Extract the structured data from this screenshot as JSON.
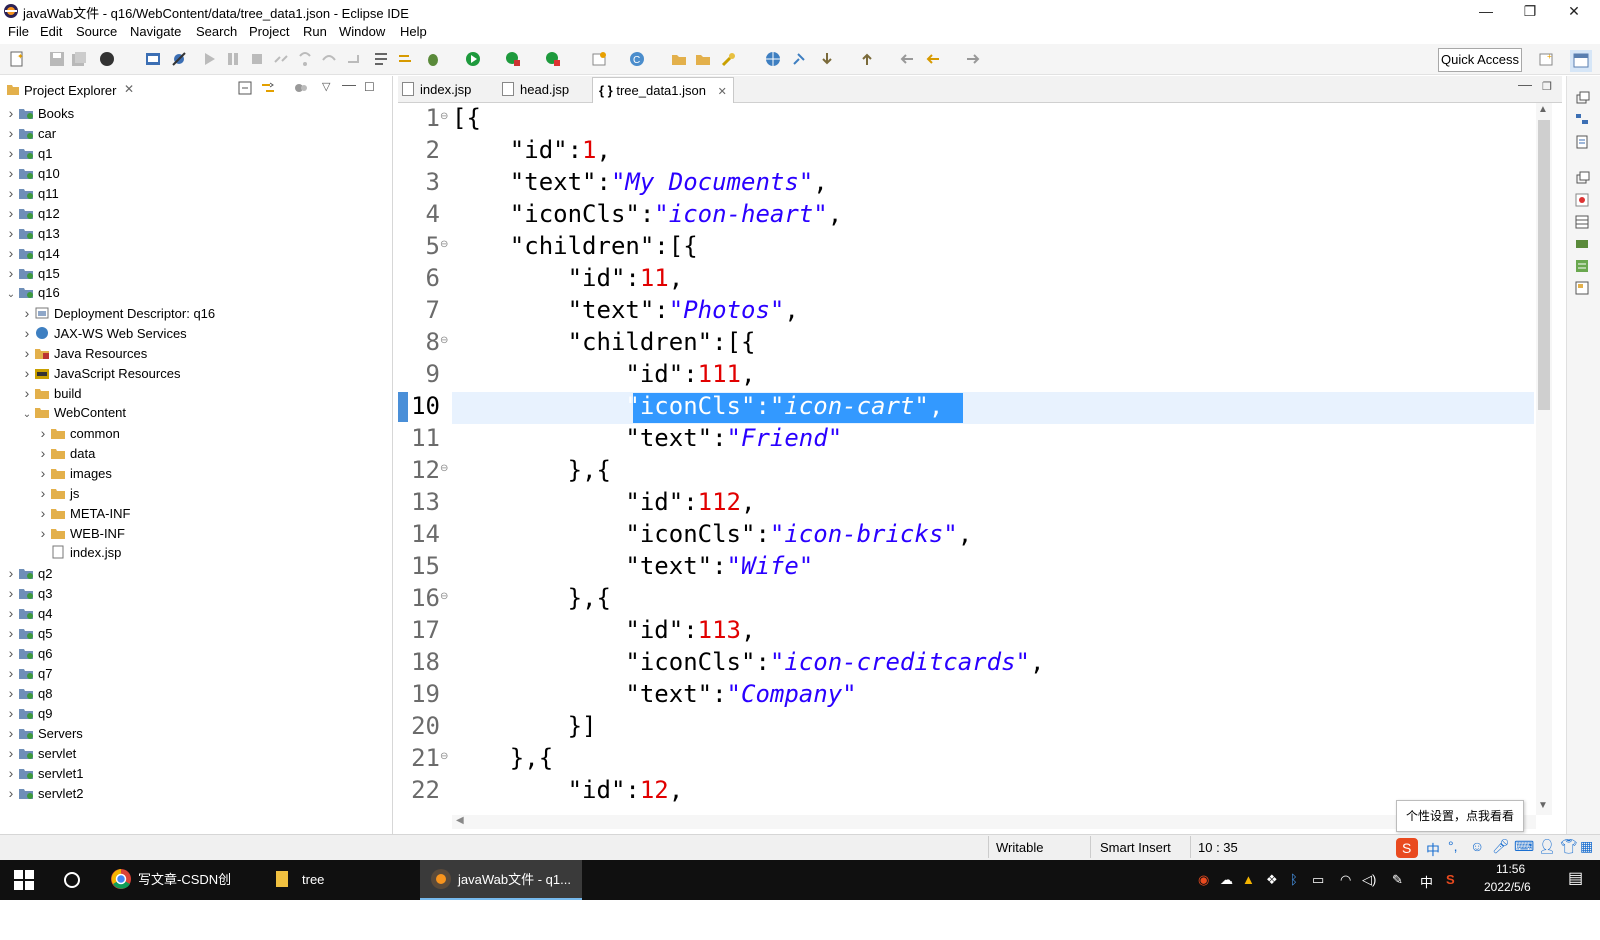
{
  "window": {
    "title": "javaWab文件 - q16/WebContent/data/tree_data1.json - Eclipse IDE",
    "minimize": "—",
    "maximize": "❐",
    "close": "✕"
  },
  "menu": [
    "File",
    "Edit",
    "Source",
    "Navigate",
    "Search",
    "Project",
    "Run",
    "Window",
    "Help"
  ],
  "toolbar": {
    "quick_access": "Quick Access"
  },
  "explorer": {
    "tab_label": "Project Explorer",
    "items": [
      {
        "label": "Books",
        "expanded": false,
        "depth": 0,
        "type": "project"
      },
      {
        "label": "car",
        "expanded": false,
        "depth": 0,
        "type": "project"
      },
      {
        "label": "q1",
        "expanded": false,
        "depth": 0,
        "type": "project"
      },
      {
        "label": "q10",
        "expanded": false,
        "depth": 0,
        "type": "project"
      },
      {
        "label": "q11",
        "expanded": false,
        "depth": 0,
        "type": "project"
      },
      {
        "label": "q12",
        "expanded": false,
        "depth": 0,
        "type": "project"
      },
      {
        "label": "q13",
        "expanded": false,
        "depth": 0,
        "type": "project"
      },
      {
        "label": "q14",
        "expanded": false,
        "depth": 0,
        "type": "project"
      },
      {
        "label": "q15",
        "expanded": false,
        "depth": 0,
        "type": "project"
      },
      {
        "label": "q16",
        "expanded": true,
        "depth": 0,
        "type": "project"
      },
      {
        "label": "Deployment Descriptor: q16",
        "expanded": false,
        "depth": 1,
        "type": "descriptor"
      },
      {
        "label": "JAX-WS Web Services",
        "expanded": false,
        "depth": 1,
        "type": "webservice"
      },
      {
        "label": "Java Resources",
        "expanded": false,
        "depth": 1,
        "type": "javares"
      },
      {
        "label": "JavaScript Resources",
        "expanded": false,
        "depth": 1,
        "type": "jsres"
      },
      {
        "label": "build",
        "expanded": false,
        "depth": 1,
        "type": "folder"
      },
      {
        "label": "WebContent",
        "expanded": true,
        "depth": 1,
        "type": "folder"
      },
      {
        "label": "common",
        "expanded": false,
        "depth": 2,
        "type": "folder"
      },
      {
        "label": "data",
        "expanded": false,
        "depth": 2,
        "type": "folder"
      },
      {
        "label": "images",
        "expanded": false,
        "depth": 2,
        "type": "folder"
      },
      {
        "label": "js",
        "expanded": false,
        "depth": 2,
        "type": "folder"
      },
      {
        "label": "META-INF",
        "expanded": false,
        "depth": 2,
        "type": "folder"
      },
      {
        "label": "WEB-INF",
        "expanded": false,
        "depth": 2,
        "type": "folder"
      },
      {
        "label": "index.jsp",
        "expanded": null,
        "depth": 2,
        "type": "file"
      },
      {
        "label": "q2",
        "expanded": false,
        "depth": 0,
        "type": "project"
      },
      {
        "label": "q3",
        "expanded": false,
        "depth": 0,
        "type": "project"
      },
      {
        "label": "q4",
        "expanded": false,
        "depth": 0,
        "type": "project"
      },
      {
        "label": "q5",
        "expanded": false,
        "depth": 0,
        "type": "project"
      },
      {
        "label": "q6",
        "expanded": false,
        "depth": 0,
        "type": "project"
      },
      {
        "label": "q7",
        "expanded": false,
        "depth": 0,
        "type": "project"
      },
      {
        "label": "q8",
        "expanded": false,
        "depth": 0,
        "type": "project"
      },
      {
        "label": "q9",
        "expanded": false,
        "depth": 0,
        "type": "project"
      },
      {
        "label": "Servers",
        "expanded": false,
        "depth": 0,
        "type": "project"
      },
      {
        "label": "servlet",
        "expanded": false,
        "depth": 0,
        "type": "project"
      },
      {
        "label": "servlet1",
        "expanded": false,
        "depth": 0,
        "type": "project"
      },
      {
        "label": "servlet2",
        "expanded": false,
        "depth": 0,
        "type": "project"
      }
    ]
  },
  "editor": {
    "tabs": [
      {
        "label": "index.jsp",
        "active": false
      },
      {
        "label": "head.jsp",
        "active": false
      },
      {
        "label": "tree_data1.json",
        "active": true,
        "prefix": "{ }"
      }
    ],
    "lines": [
      {
        "n": "1",
        "fold": true,
        "indent": 0,
        "tokens": [
          [
            "punc",
            "[{"
          ]
        ]
      },
      {
        "n": "2",
        "fold": false,
        "indent": 1,
        "tokens": [
          [
            "keyq",
            "\"id\""
          ],
          [
            "punc",
            ":"
          ],
          [
            "num",
            "1"
          ],
          [
            "punc",
            ","
          ]
        ]
      },
      {
        "n": "3",
        "fold": false,
        "indent": 1,
        "tokens": [
          [
            "keyq",
            "\"text\""
          ],
          [
            "punc",
            ":"
          ],
          [
            "str",
            "\"My Documents\""
          ],
          [
            "punc",
            ","
          ]
        ]
      },
      {
        "n": "4",
        "fold": false,
        "indent": 1,
        "tokens": [
          [
            "keyq",
            "\"iconCls\""
          ],
          [
            "punc",
            ":"
          ],
          [
            "str",
            "\"icon-heart\""
          ],
          [
            "punc",
            ","
          ]
        ]
      },
      {
        "n": "5",
        "fold": true,
        "indent": 1,
        "tokens": [
          [
            "keyq",
            "\"children\""
          ],
          [
            "punc",
            ":[{"
          ]
        ]
      },
      {
        "n": "6",
        "fold": false,
        "indent": 2,
        "tokens": [
          [
            "keyq",
            "\"id\""
          ],
          [
            "punc",
            ":"
          ],
          [
            "num",
            "11"
          ],
          [
            "punc",
            ","
          ]
        ]
      },
      {
        "n": "7",
        "fold": false,
        "indent": 2,
        "tokens": [
          [
            "keyq",
            "\"text\""
          ],
          [
            "punc",
            ":"
          ],
          [
            "str",
            "\"Photos\""
          ],
          [
            "punc",
            ","
          ]
        ]
      },
      {
        "n": "8",
        "fold": true,
        "indent": 2,
        "tokens": [
          [
            "keyq",
            "\"children\""
          ],
          [
            "punc",
            ":[{"
          ]
        ]
      },
      {
        "n": "9",
        "fold": false,
        "indent": 3,
        "tokens": [
          [
            "keyq",
            "\"id\""
          ],
          [
            "punc",
            ":"
          ],
          [
            "num",
            "111"
          ],
          [
            "punc",
            ","
          ]
        ]
      },
      {
        "n": "10",
        "fold": false,
        "indent": 3,
        "selected": true,
        "tokens": [
          [
            "keyq",
            "\"iconCls\""
          ],
          [
            "punc",
            ":"
          ],
          [
            "str",
            "\"icon-cart\""
          ],
          [
            "punc",
            ","
          ]
        ]
      },
      {
        "n": "11",
        "fold": false,
        "indent": 3,
        "tokens": [
          [
            "keyq",
            "\"text\""
          ],
          [
            "punc",
            ":"
          ],
          [
            "str",
            "\"Friend\""
          ]
        ]
      },
      {
        "n": "12",
        "fold": true,
        "indent": 2,
        "tokens": [
          [
            "punc",
            "},{"
          ]
        ]
      },
      {
        "n": "13",
        "fold": false,
        "indent": 3,
        "tokens": [
          [
            "keyq",
            "\"id\""
          ],
          [
            "punc",
            ":"
          ],
          [
            "num",
            "112"
          ],
          [
            "punc",
            ","
          ]
        ]
      },
      {
        "n": "14",
        "fold": false,
        "indent": 3,
        "tokens": [
          [
            "keyq",
            "\"iconCls\""
          ],
          [
            "punc",
            ":"
          ],
          [
            "str",
            "\"icon-bricks\""
          ],
          [
            "punc",
            ","
          ]
        ]
      },
      {
        "n": "15",
        "fold": false,
        "indent": 3,
        "tokens": [
          [
            "keyq",
            "\"text\""
          ],
          [
            "punc",
            ":"
          ],
          [
            "str",
            "\"Wife\""
          ]
        ]
      },
      {
        "n": "16",
        "fold": true,
        "indent": 2,
        "tokens": [
          [
            "punc",
            "},{"
          ]
        ]
      },
      {
        "n": "17",
        "fold": false,
        "indent": 3,
        "tokens": [
          [
            "keyq",
            "\"id\""
          ],
          [
            "punc",
            ":"
          ],
          [
            "num",
            "113"
          ],
          [
            "punc",
            ","
          ]
        ]
      },
      {
        "n": "18",
        "fold": false,
        "indent": 3,
        "tokens": [
          [
            "keyq",
            "\"iconCls\""
          ],
          [
            "punc",
            ":"
          ],
          [
            "str",
            "\"icon-creditcards\""
          ],
          [
            "punc",
            ","
          ]
        ]
      },
      {
        "n": "19",
        "fold": false,
        "indent": 3,
        "tokens": [
          [
            "keyq",
            "\"text\""
          ],
          [
            "punc",
            ":"
          ],
          [
            "str",
            "\"Company\""
          ]
        ]
      },
      {
        "n": "20",
        "fold": false,
        "indent": 2,
        "tokens": [
          [
            "punc",
            "}]"
          ]
        ]
      },
      {
        "n": "21",
        "fold": true,
        "indent": 1,
        "tokens": [
          [
            "punc",
            "},{"
          ]
        ]
      },
      {
        "n": "22",
        "fold": false,
        "indent": 2,
        "tokens": [
          [
            "keyq",
            "\"id\""
          ],
          [
            "punc",
            ":"
          ],
          [
            "num",
            "12"
          ],
          [
            "punc",
            ","
          ]
        ]
      }
    ]
  },
  "status": {
    "writable": "Writable",
    "insert_mode": "Smart Insert",
    "position": "10 : 35"
  },
  "ime_tooltip": "个性设置，点我看看",
  "taskbar": {
    "items": [
      "写文章-CSDN创作...",
      "tree",
      "javaWab文件 - q1..."
    ],
    "time": "11:56",
    "date": "2022/5/6",
    "ime_lang": "中"
  },
  "colors": {
    "selection": "#3399ff",
    "current_line": "#e8f2fe",
    "string": "#2a00ff",
    "number": "#e10000"
  }
}
